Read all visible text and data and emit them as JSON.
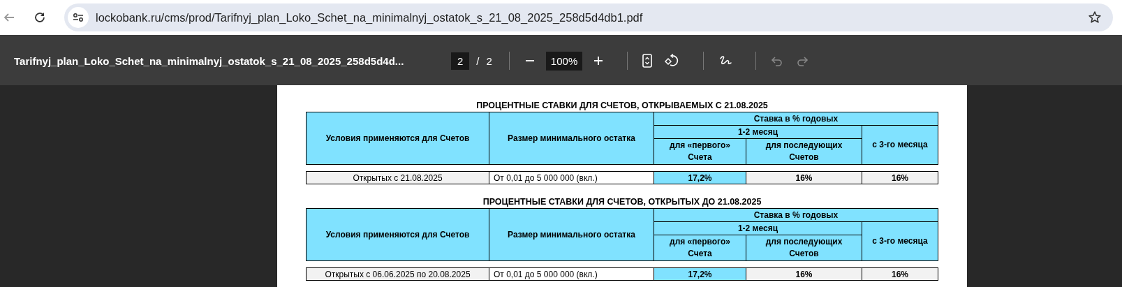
{
  "browser": {
    "back_disabled": true,
    "url": "lockobank.ru/cms/prod/Tarifnyj_plan_Loko_Schet_na_minimalnyj_ostatok_s_21_08_2025_258d5d4db1.pdf"
  },
  "pdf_toolbar": {
    "title": "Tarifnyj_plan_Loko_Schet_na_minimalnyj_ostatok_s_21_08_2025_258d5d4d...",
    "page": "2",
    "separator": "/",
    "page_count": "2",
    "zoom": "100%",
    "undo_disabled": true,
    "redo_disabled": true
  },
  "document": {
    "tables": [
      {
        "title": "ПРОЦЕНТНЫЕ СТАВКИ ДЛЯ СЧЕТОВ, ОТКРЫВАЕМЫХ С 21.08.2025",
        "header": {
          "conditions": "Условия применяются для Счетов",
          "min_balance": "Размер минимального остатка",
          "rate_group": "Ставка в % годовых",
          "period_group": "1-2 месяц",
          "first_account": "для «первого» Счета",
          "next_accounts": "для последующих Счетов",
          "from_third_month": "с 3-го месяца"
        },
        "rows": [
          {
            "cells": [
              {
                "text": "Открытых с 21.08.2025",
                "kind": "shaded"
              },
              {
                "text": "От 0,01 до 5 000 000 (вкл.)",
                "kind": "plain"
              },
              {
                "text": "17,2%",
                "kind": "highlight"
              },
              {
                "text": "16%",
                "kind": "rate"
              },
              {
                "text": "16%",
                "kind": "rate"
              }
            ]
          }
        ]
      },
      {
        "title": "ПРОЦЕНТНЫЕ СТАВКИ ДЛЯ СЧЕТОВ, ОТКРЫТЫХ ДО 21.08.2025",
        "header": {
          "conditions": "Условия применяются для Счетов",
          "min_balance": "Размер минимального остатка",
          "rate_group": "Ставка в % годовых",
          "period_group": "1-2 месяц",
          "first_account": "для «первого» Счета",
          "next_accounts": "для последующих Счетов",
          "from_third_month": "с 3-го месяца"
        },
        "rows": [
          {
            "cells": [
              {
                "text": "Открытых с 06.06.2025 по 20.08.2025",
                "kind": "shaded"
              },
              {
                "text": "От 0,01 до 5 000 000 (вкл.)",
                "kind": "plain"
              },
              {
                "text": "17,2%",
                "kind": "highlight"
              },
              {
                "text": "16%",
                "kind": "rate"
              },
              {
                "text": "16%",
                "kind": "rate"
              }
            ]
          }
        ]
      }
    ]
  }
}
